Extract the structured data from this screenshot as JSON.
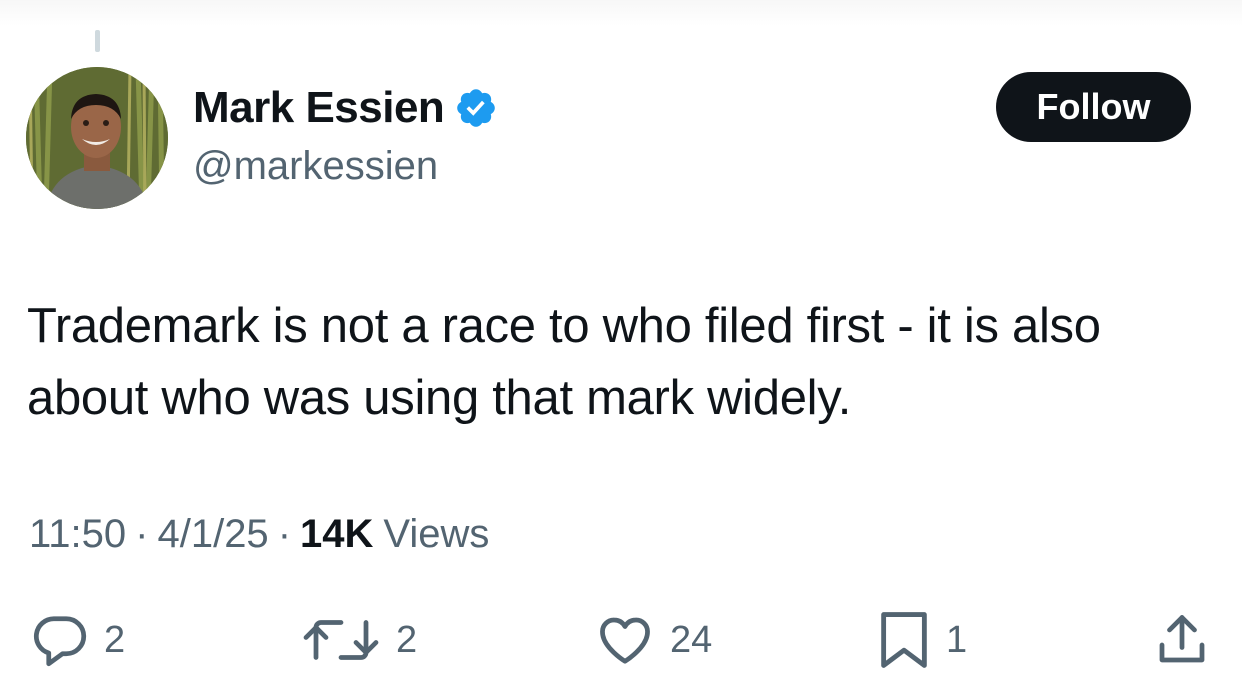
{
  "author": {
    "display_name": "Mark Essien",
    "handle": "@markessien",
    "verified": true
  },
  "follow_label": "Follow",
  "tweet": {
    "text": "Trademark is not a race to who filed first - it is also about who was using that mark widely."
  },
  "meta": {
    "time": "11:50",
    "separator": "·",
    "date": "4/1/25",
    "views_count": "14K",
    "views_label": "Views"
  },
  "actions": {
    "replies": "2",
    "reposts": "2",
    "likes": "24",
    "bookmarks": "1"
  },
  "colors": {
    "text_primary": "#0f1419",
    "text_secondary": "#536471",
    "verified_blue": "#1d9bf0",
    "follow_bg": "#0f1419"
  },
  "icons": [
    "reply-icon",
    "repost-icon",
    "like-icon",
    "bookmark-icon",
    "share-icon",
    "verified-badge-icon"
  ]
}
